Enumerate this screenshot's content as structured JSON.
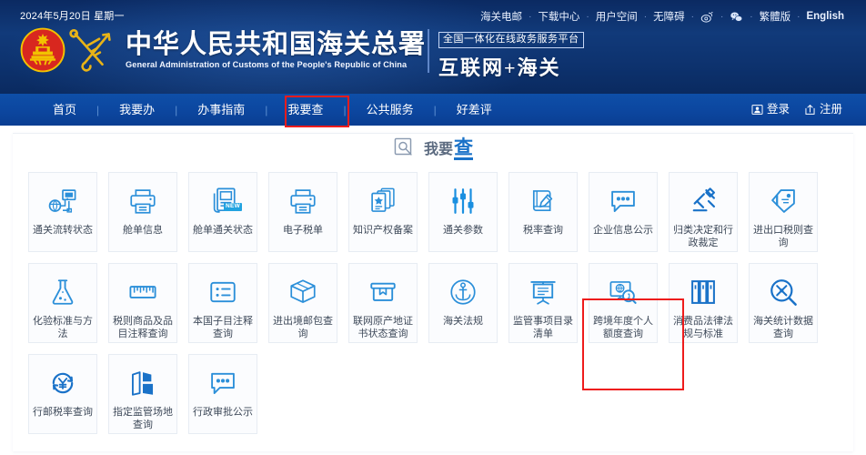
{
  "header": {
    "date": "2024年5月20日  星期一",
    "top_links": [
      {
        "label": "海关电邮",
        "type": "text"
      },
      {
        "label": "下载中心",
        "type": "text"
      },
      {
        "label": "用户空间",
        "type": "text"
      },
      {
        "label": "无障碍",
        "type": "text"
      },
      {
        "label": "weibo-icon",
        "type": "icon"
      },
      {
        "label": "wechat-icon",
        "type": "icon"
      },
      {
        "label": "繁體版",
        "type": "text"
      },
      {
        "label": "English",
        "type": "text"
      }
    ],
    "brand_cn": "中华人民共和国海关总署",
    "brand_en": "General Administration of Customs of the People's Republic of China",
    "platform_tag": "全国一体化在线政务服务平台",
    "platform_main": "互联网+海关",
    "emblem_icon": "national-emblem-icon",
    "customs_badge_icon": "customs-key-anchor-icon"
  },
  "nav": {
    "items": [
      {
        "label": "首页",
        "active": false
      },
      {
        "label": "我要办",
        "active": false
      },
      {
        "label": "办事指南",
        "active": false
      },
      {
        "label": "我要查",
        "active": true
      },
      {
        "label": "公共服务",
        "active": false
      },
      {
        "label": "好差评",
        "active": false
      }
    ],
    "separator": "|",
    "login_label": "登录",
    "register_label": "注册",
    "login_icon": "user-card-icon",
    "register_icon": "upload-box-icon",
    "highlight_color": "#ee1c1c"
  },
  "section": {
    "title_prefix": "我要",
    "title_main": "查",
    "search_icon": "magnifier-square-icon",
    "accent_color": "#1a72c8"
  },
  "cards": [
    {
      "label": "通关流转状态",
      "icon": "network-monitor-icon",
      "badge": null,
      "highlighted": false
    },
    {
      "label": "舱单信息",
      "icon": "printer-icon",
      "badge": null,
      "highlighted": false
    },
    {
      "label": "舱单通关状态",
      "icon": "document-stack-icon",
      "badge": "NEW",
      "highlighted": false
    },
    {
      "label": "电子税单",
      "icon": "printer-icon",
      "badge": null,
      "highlighted": false
    },
    {
      "label": "知识产权备案",
      "icon": "star-certificate-icon",
      "badge": null,
      "highlighted": false
    },
    {
      "label": "通关参数",
      "icon": "sliders-icon",
      "badge": null,
      "highlighted": false
    },
    {
      "label": "税率查询",
      "icon": "book-pen-icon",
      "badge": null,
      "highlighted": false
    },
    {
      "label": "企业信息公示",
      "icon": "speech-bubble-dots-icon",
      "badge": null,
      "highlighted": true
    },
    {
      "label": "归类决定和行政裁定",
      "icon": "gavel-icon",
      "badge": null,
      "highlighted": false
    },
    {
      "label": "进出口税则查询",
      "icon": "tax-tag-icon",
      "badge": null,
      "highlighted": false
    },
    {
      "label": "化验标准与方法",
      "icon": "flask-icon",
      "badge": null,
      "highlighted": false
    },
    {
      "label": "税则商品及品目注释查询",
      "icon": "ruler-icon",
      "badge": null,
      "highlighted": false
    },
    {
      "label": "本国子目注释查询",
      "icon": "list-icon",
      "badge": null,
      "highlighted": false
    },
    {
      "label": "进出境邮包查询",
      "icon": "parcel-box-icon",
      "badge": null,
      "highlighted": false
    },
    {
      "label": "联网原产地证书状态查询",
      "icon": "archive-box-icon",
      "badge": null,
      "highlighted": false
    },
    {
      "label": "海关法规",
      "icon": "anchor-circle-icon",
      "badge": null,
      "highlighted": false
    },
    {
      "label": "监管事项目录清单",
      "icon": "presentation-board-icon",
      "badge": null,
      "highlighted": false
    },
    {
      "label": "跨境年度个人额度查询",
      "icon": "monitor-search-icon",
      "badge": null,
      "highlighted": false
    },
    {
      "label": "消费品法律法规与标准",
      "icon": "books-icon",
      "badge": null,
      "highlighted": false
    },
    {
      "label": "海关统计数据查询",
      "icon": "stats-magnifier-icon",
      "badge": null,
      "highlighted": false
    },
    {
      "label": "行邮税率查询",
      "icon": "yuan-refresh-icon",
      "badge": null,
      "highlighted": false
    },
    {
      "label": "指定监管场地查询",
      "icon": "site-map-icon",
      "badge": null,
      "highlighted": false
    },
    {
      "label": "行政审批公示",
      "icon": "speech-bubble-dots-icon",
      "badge": null,
      "highlighted": false
    }
  ]
}
